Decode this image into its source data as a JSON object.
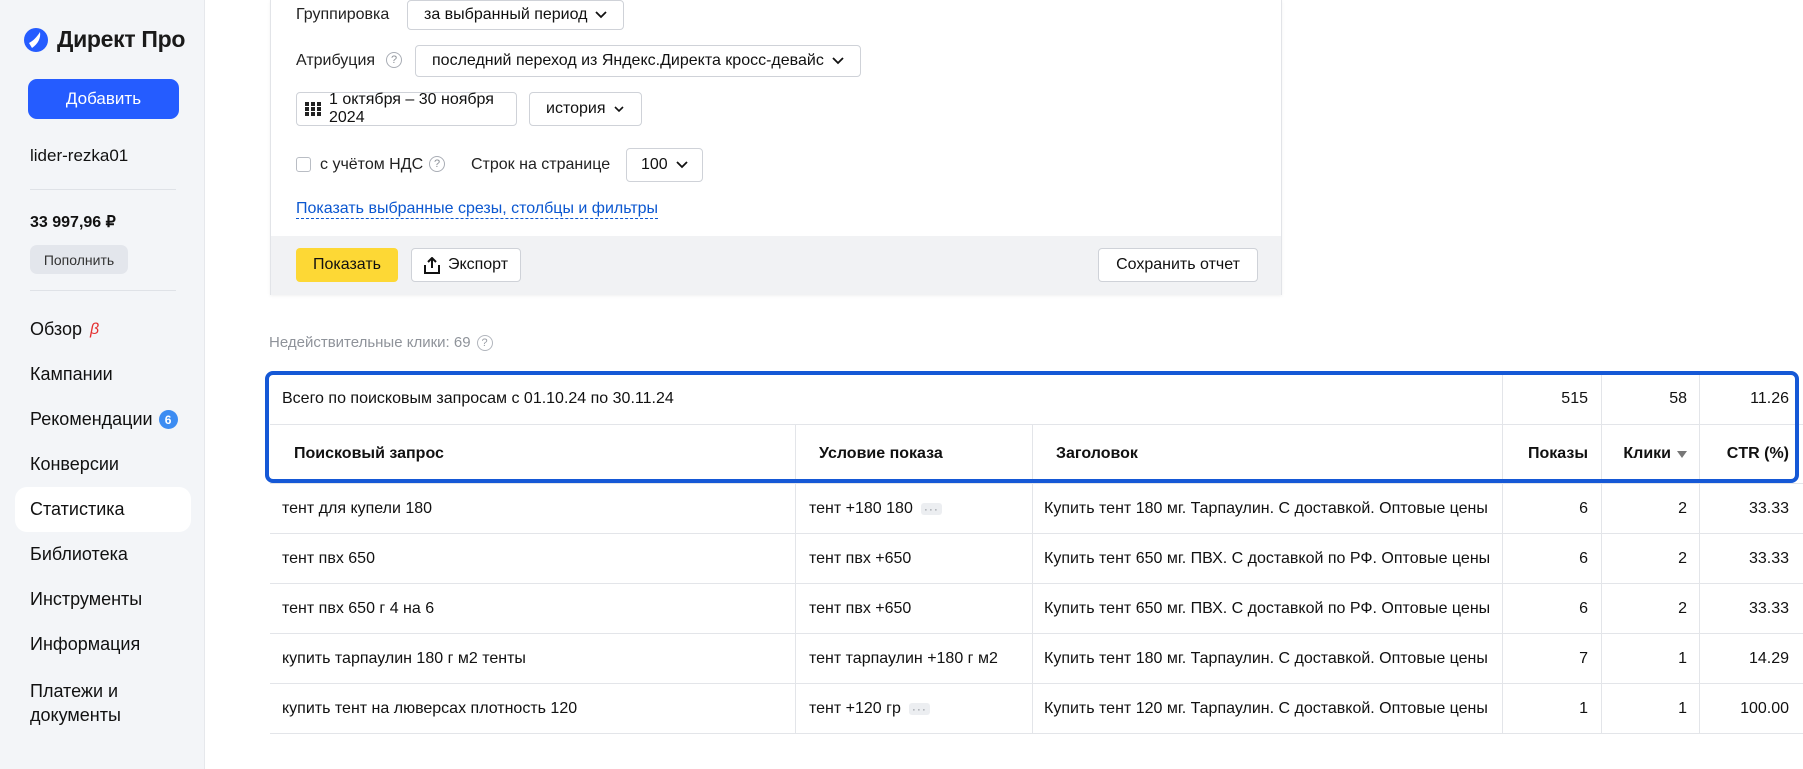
{
  "sidebar": {
    "brand": "Директ Про",
    "add_label": "Добавить",
    "login": "lider-rezka01",
    "balance": "33 997,96 ₽",
    "topup_label": "Пополнить",
    "nav": [
      {
        "label": "Обзор",
        "beta": "β"
      },
      {
        "label": "Кампании"
      },
      {
        "label": "Рекомендации",
        "badge": "6"
      },
      {
        "label": "Конверсии"
      },
      {
        "label": "Статистика",
        "active": true
      },
      {
        "label": "Библиотека"
      },
      {
        "label": "Инструменты"
      },
      {
        "label": "Информация"
      },
      {
        "label": "Платежи и документы"
      }
    ]
  },
  "filters": {
    "grouping_label": "Группировка",
    "grouping_value": "за выбранный период",
    "attribution_label": "Атрибуция",
    "attribution_value": "последний переход из Яндекс.Директа кросс-девайс",
    "date_range": "1 октября – 30 ноября 2024",
    "period_preset": "история",
    "vat_label": "с учётом НДС",
    "rows_label": "Строк на странице",
    "rows_value": "100",
    "show_slices_link": "Показать выбранные срезы, столбцы и фильтры",
    "show_button": "Показать",
    "export_button": "Экспорт",
    "save_report_button": "Сохранить отчет"
  },
  "invalid_clicks": "Недействительные клики: 69",
  "table": {
    "total": {
      "label": "Всего по поисковым запросам с 01.10.24 по 30.11.24",
      "impressions": "515",
      "clicks": "58",
      "ctr": "11.26"
    },
    "columns": {
      "query": "Поисковый запрос",
      "condition": "Условие показа",
      "headline": "Заголовок",
      "impressions": "Показы",
      "clicks": "Клики",
      "ctr": "CTR (%)"
    },
    "rows": [
      {
        "query": "тент для купели 180",
        "condition": "тент +180 180",
        "more": true,
        "headline": "Купить тент 180 мг. Тарпаулин. С доставкой. Оптовые цены",
        "impressions": "6",
        "clicks": "2",
        "ctr": "33.33"
      },
      {
        "query": "тент пвх 650",
        "condition": "тент пвх +650",
        "more": false,
        "headline": "Купить тент 650 мг. ПВХ. С доставкой по РФ. Оптовые цены",
        "impressions": "6",
        "clicks": "2",
        "ctr": "33.33"
      },
      {
        "query": "тент пвх 650 г 4 на 6",
        "condition": "тент пвх +650",
        "more": false,
        "headline": "Купить тент 650 мг. ПВХ. С доставкой по РФ. Оптовые цены",
        "impressions": "6",
        "clicks": "2",
        "ctr": "33.33"
      },
      {
        "query": "купить тарпаулин 180 г м2 тенты",
        "condition": "тент тарпаулин +180 г м2",
        "more": false,
        "headline": "Купить тент 180 мг. Тарпаулин. С доставкой. Оптовые цены",
        "impressions": "7",
        "clicks": "1",
        "ctr": "14.29"
      },
      {
        "query": "купить тент на люверсах плотность 120",
        "condition": "тент +120 гр",
        "more": true,
        "headline": "Купить тент 120 мг. Тарпаулин. С доставкой. Оптовые цены",
        "impressions": "1",
        "clicks": "1",
        "ctr": "100.00"
      }
    ]
  }
}
